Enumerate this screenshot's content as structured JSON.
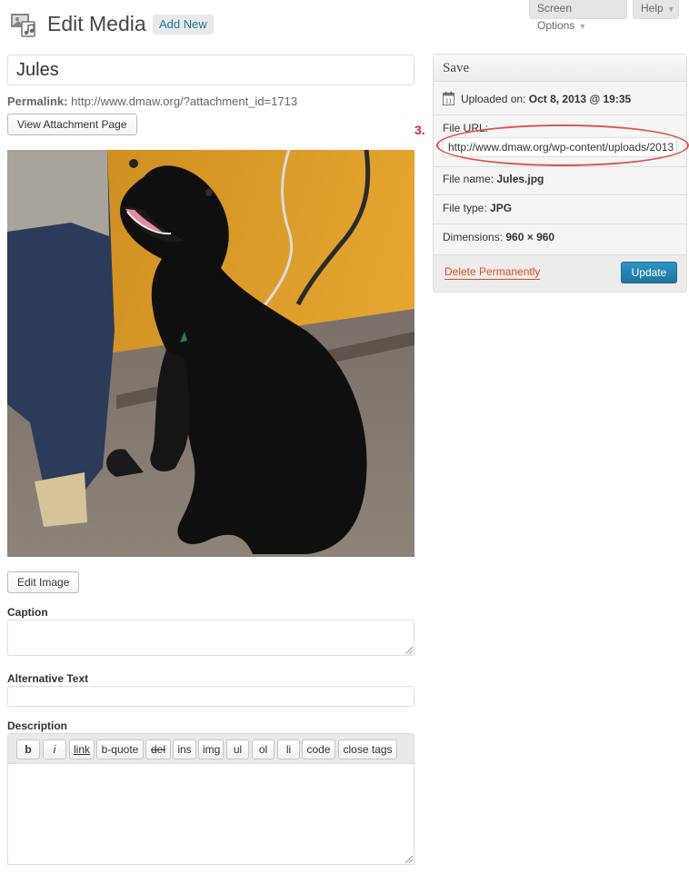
{
  "header": {
    "title": "Edit Media",
    "add_new": "Add New",
    "screen_options": "Screen Options",
    "help": "Help"
  },
  "attachment": {
    "title": "Jules",
    "permalink_label": "Permalink:",
    "permalink_url": "http://www.dmaw.org/?attachment_id=1713",
    "view_button": "View Attachment Page",
    "edit_image_button": "Edit Image"
  },
  "fields": {
    "caption_label": "Caption",
    "alt_label": "Alternative Text",
    "description_label": "Description"
  },
  "quicktags": [
    "b",
    "i",
    "link",
    "b-quote",
    "del",
    "ins",
    "img",
    "ul",
    "ol",
    "li",
    "code",
    "close tags"
  ],
  "save_box": {
    "title": "Save",
    "uploaded_label": "Uploaded on:",
    "uploaded_value": "Oct 8, 2013 @ 19:35",
    "file_url_label": "File URL:",
    "file_url_value": "http://www.dmaw.org/wp-content/uploads/2013",
    "file_name_label": "File name:",
    "file_name_value": "Jules.jpg",
    "file_type_label": "File type:",
    "file_type_value": "JPG",
    "dimensions_label": "Dimensions:",
    "dimensions_value": "960 × 960",
    "delete": "Delete Permanently",
    "update": "Update"
  },
  "annotation": {
    "step": "3.",
    "color": "#d9534f"
  },
  "icons": {
    "media": "media-library-icon",
    "calendar": "calendar-icon",
    "dropdown": "chevron-down-icon",
    "resize": "resize-grip-icon"
  },
  "colors": {
    "link": "#21759b",
    "primary": "#21759b",
    "danger": "#d54e21"
  }
}
